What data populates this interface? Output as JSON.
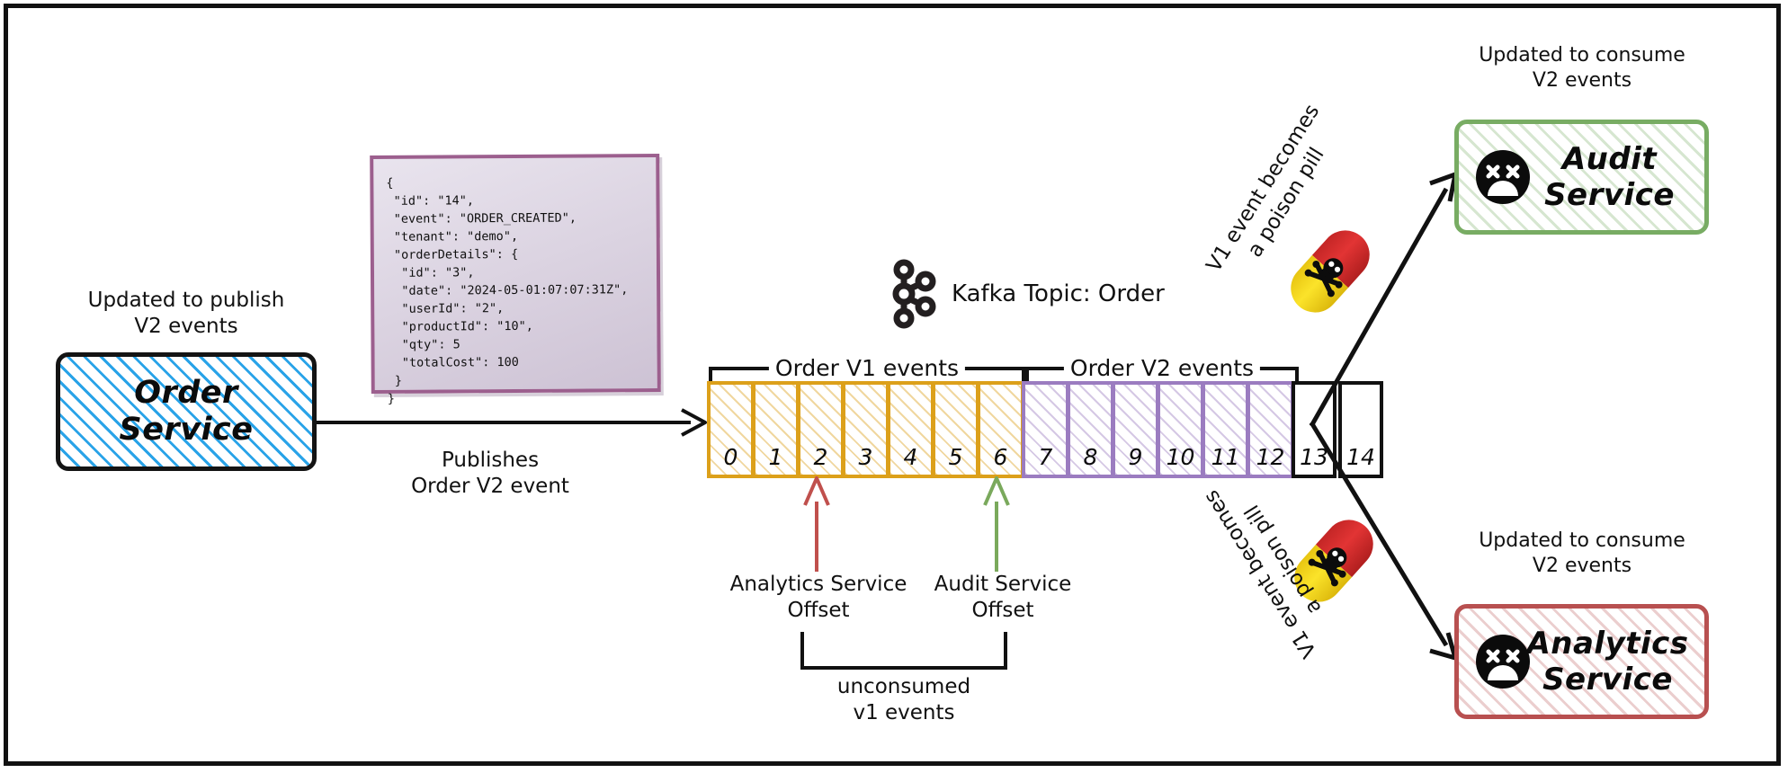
{
  "diagram": {
    "title": "Kafka poison pill schema evolution diagram",
    "frame_color": "#111111"
  },
  "producer": {
    "caption": "Updated to publish\nV2 events",
    "box_label": "Order\nService",
    "box_border_color": "#141414",
    "hatch_color": "#29a3e8"
  },
  "publish_arrow": {
    "label": "Publishes\nOrder V2 event"
  },
  "note": {
    "icon": "sticky-note",
    "border_color": "#9c5f8e",
    "json_text": "{\n \"id\": \"14\",\n \"event\": \"ORDER_CREATED\",\n \"tenant\": \"demo\",\n \"orderDetails\": {\n  \"id\": \"3\",\n  \"date\": \"2024-05-01:07:07:31Z\",\n  \"userId\": \"2\",\n  \"productId\": \"10\",\n  \"qty\": 5\n  \"totalCost\": 100\n }\n}"
  },
  "kafka": {
    "icon": "kafka-logo-icon",
    "topic_label": "Kafka Topic: Order"
  },
  "partition": {
    "brackets": [
      {
        "label": "Order V1 events",
        "start": 0,
        "end": 6,
        "color": "#dca01a"
      },
      {
        "label": "Order V2 events",
        "start": 7,
        "end": 12,
        "color": "#9b7cc0"
      }
    ],
    "cells": [
      {
        "offset": "0",
        "kind": "v1"
      },
      {
        "offset": "1",
        "kind": "v1"
      },
      {
        "offset": "2",
        "kind": "v1"
      },
      {
        "offset": "3",
        "kind": "v1"
      },
      {
        "offset": "4",
        "kind": "v1"
      },
      {
        "offset": "5",
        "kind": "v1"
      },
      {
        "offset": "6",
        "kind": "v1"
      },
      {
        "offset": "7",
        "kind": "v2"
      },
      {
        "offset": "8",
        "kind": "v2"
      },
      {
        "offset": "9",
        "kind": "v2"
      },
      {
        "offset": "10",
        "kind": "v2"
      },
      {
        "offset": "11",
        "kind": "v2"
      },
      {
        "offset": "12",
        "kind": "v2"
      },
      {
        "offset": "13",
        "kind": "plain"
      },
      {
        "offset": "14",
        "kind": "plain"
      }
    ]
  },
  "offsets": [
    {
      "name": "analytics-service-offset",
      "label": "Analytics Service\nOffset",
      "points_to_offset": "2",
      "color": "#c0504d"
    },
    {
      "name": "audit-service-offset",
      "label": "Audit Service\nOffset",
      "points_to_offset": "6",
      "color": "#7aa95c"
    }
  ],
  "unconsumed": {
    "label": "unconsumed\nv1 events",
    "from_offset": "2",
    "to_offset": "6"
  },
  "poison_pills": [
    {
      "name": "poison-pill-top",
      "caption": "V1 event becomes\na poison pill",
      "cap_top_color": "#dd2f2f",
      "cap_bottom_color": "#f7d91c",
      "icon": "skull-and-crossbones-icon"
    },
    {
      "name": "poison-pill-bottom",
      "caption": "V1 event becomes\na poison pill",
      "cap_top_color": "#dd2f2f",
      "cap_bottom_color": "#f7d91c",
      "icon": "skull-and-crossbones-icon"
    }
  ],
  "consumers": [
    {
      "name": "audit-service",
      "caption": "Updated to consume\nV2 events",
      "box_label": "Audit\nService",
      "border_color": "#78ac63",
      "status_icon": "dead-face-icon"
    },
    {
      "name": "analytics-service",
      "caption": "Updated to consume\nV2 events",
      "box_label": "Analytics\nService",
      "border_color": "#b85050",
      "status_icon": "dead-face-icon"
    }
  ]
}
